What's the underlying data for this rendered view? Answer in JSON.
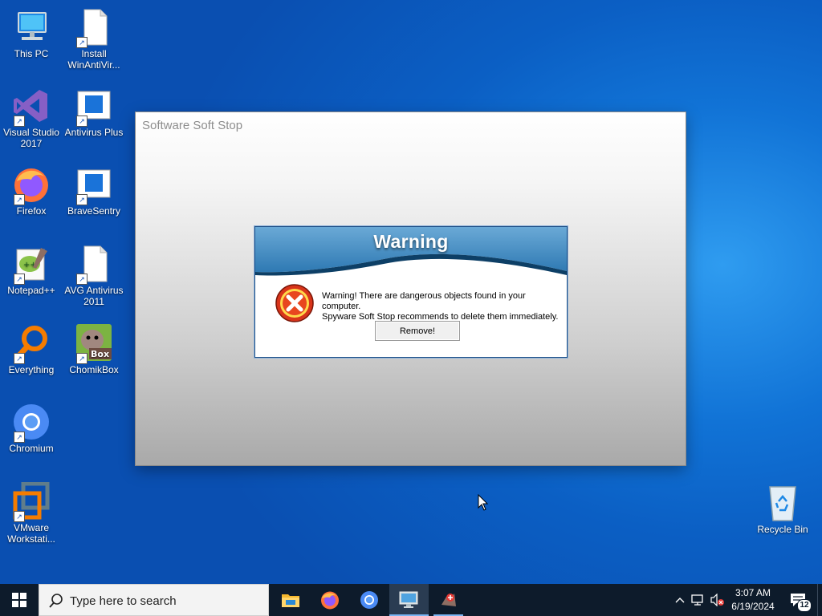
{
  "desktop": {
    "icons": [
      {
        "label": "This PC"
      },
      {
        "label": "Install WinAntiVir..."
      },
      {
        "label": "Visual Studio 2017"
      },
      {
        "label": "Antivirus Plus"
      },
      {
        "label": "Firefox"
      },
      {
        "label": "BraveSentry"
      },
      {
        "label": "Notepad++"
      },
      {
        "label": "AVG Antivirus 2011"
      },
      {
        "label": "Everything"
      },
      {
        "label": "ChomikBox"
      },
      {
        "label": "Chromium"
      },
      {
        "label": "VMware Workstati..."
      },
      {
        "label": "Recycle Bin"
      }
    ]
  },
  "window": {
    "title": "Software Soft Stop"
  },
  "dialog": {
    "heading": "Warning",
    "message_line1": "Warning! There are dangerous objects found in your computer.",
    "message_line2": "Spyware Soft Stop recommends to delete them immediately.",
    "button_label": "Remove!"
  },
  "taskbar": {
    "search_placeholder": "Type here to search",
    "pinned": [
      {
        "icon": "file-explorer-icon"
      },
      {
        "icon": "firefox-icon"
      },
      {
        "icon": "chromium-icon"
      },
      {
        "icon": "remote-desktop-icon",
        "state": "active"
      },
      {
        "icon": "software-soft-stop-icon",
        "state": "running"
      }
    ],
    "tray": {
      "time": "3:07 AM",
      "date": "6/19/2024",
      "notification_count": "12"
    }
  },
  "colors": {
    "desktop_blue": "#0b5fc4",
    "taskbar": "#0d1b2b",
    "dialog_header": "#3b8ac4",
    "error_red": "#d8341a"
  }
}
